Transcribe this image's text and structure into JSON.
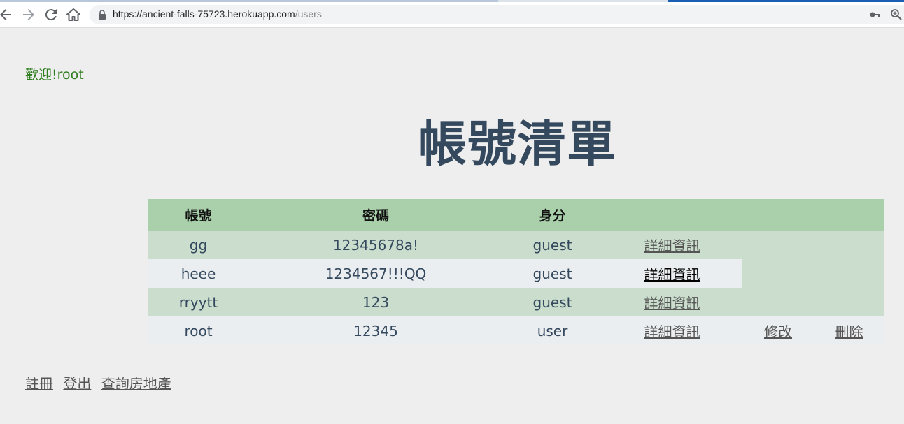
{
  "browser": {
    "url_host": "https://ancient-falls-75723.herokuapp.com",
    "url_path": "/users",
    "icons": [
      "back-icon",
      "forward-icon",
      "reload-icon",
      "home-icon",
      "lock-icon",
      "key-icon",
      "zoom-icon"
    ]
  },
  "welcome": "歡迎!root",
  "page_title": "帳號清單",
  "table": {
    "headers": [
      "帳號",
      "密碼",
      "身分"
    ],
    "rows": [
      {
        "account": "gg",
        "password": "12345678a!",
        "role": "guest",
        "detail": "詳細資訊"
      },
      {
        "account": "heee",
        "password": "1234567!!!QQ",
        "role": "guest",
        "detail": "詳細資訊"
      },
      {
        "account": "rryytt",
        "password": "123",
        "role": "guest",
        "detail": "詳細資訊"
      },
      {
        "account": "root",
        "password": "12345",
        "role": "user",
        "detail": "詳細資訊",
        "edit": "修改",
        "delete": "刪除"
      }
    ]
  },
  "footer": {
    "register": "註冊",
    "logout": "登出",
    "search_property": "查詢房地產"
  },
  "colors": {
    "header_bg": "#aacfab",
    "row_green": "#cbdecd",
    "row_gray": "#ebeef0",
    "title": "#34495e",
    "welcome": "#2e7d1e"
  }
}
